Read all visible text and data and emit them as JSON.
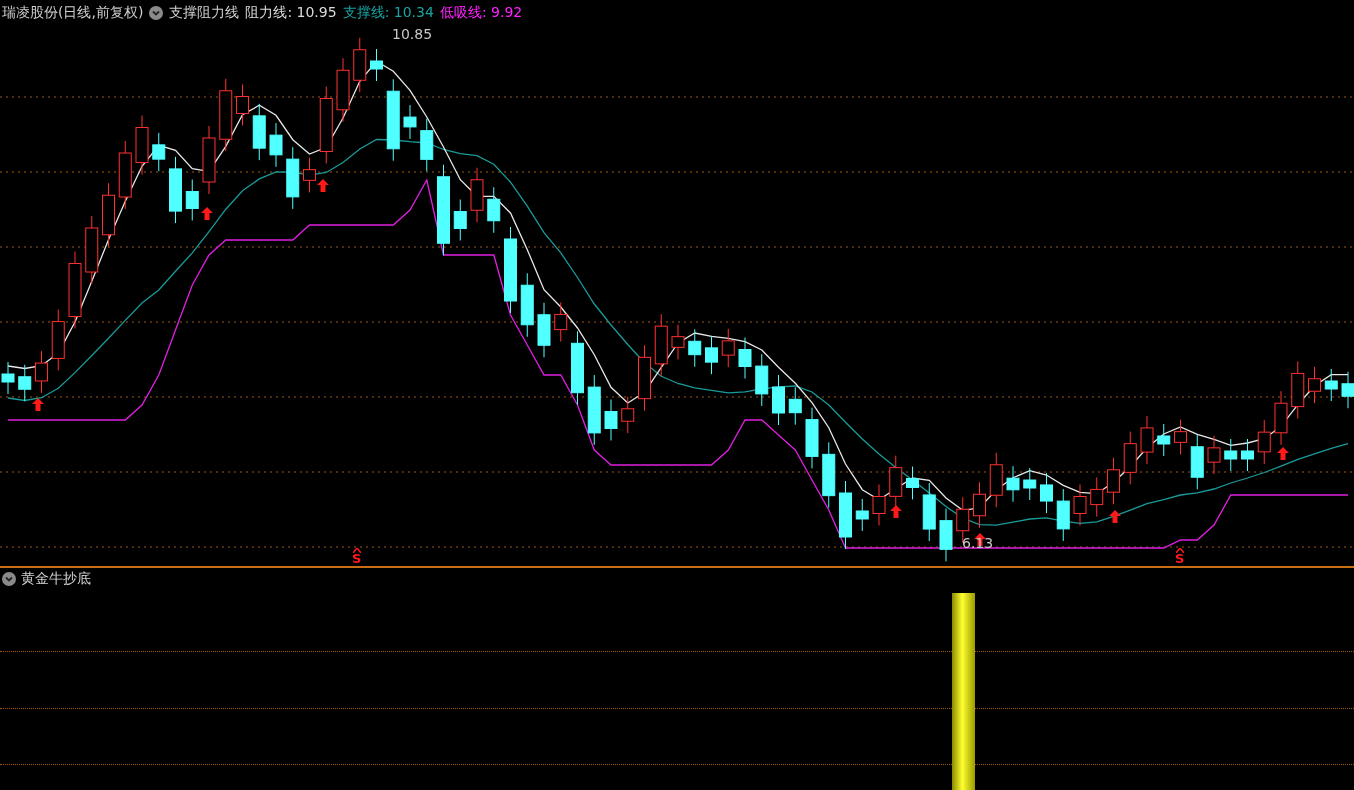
{
  "main_panel": {
    "title": "瑞凌股份(日线,前复权)",
    "indicator": "支撑阻力线",
    "readouts": [
      {
        "label": "阻力线: 10.95",
        "color": "#dcdcdc"
      },
      {
        "label": "支撑线: 10.34",
        "color": "#1aa3a3"
      },
      {
        "label": "低吸线: 9.92",
        "color": "#ff22ff"
      }
    ],
    "high_label": "10.85",
    "low_label": "6.13",
    "signals": [
      {
        "text": "S"
      },
      {
        "text": "S"
      }
    ]
  },
  "sub_panel": {
    "indicator": "黄金牛抄底"
  }
}
